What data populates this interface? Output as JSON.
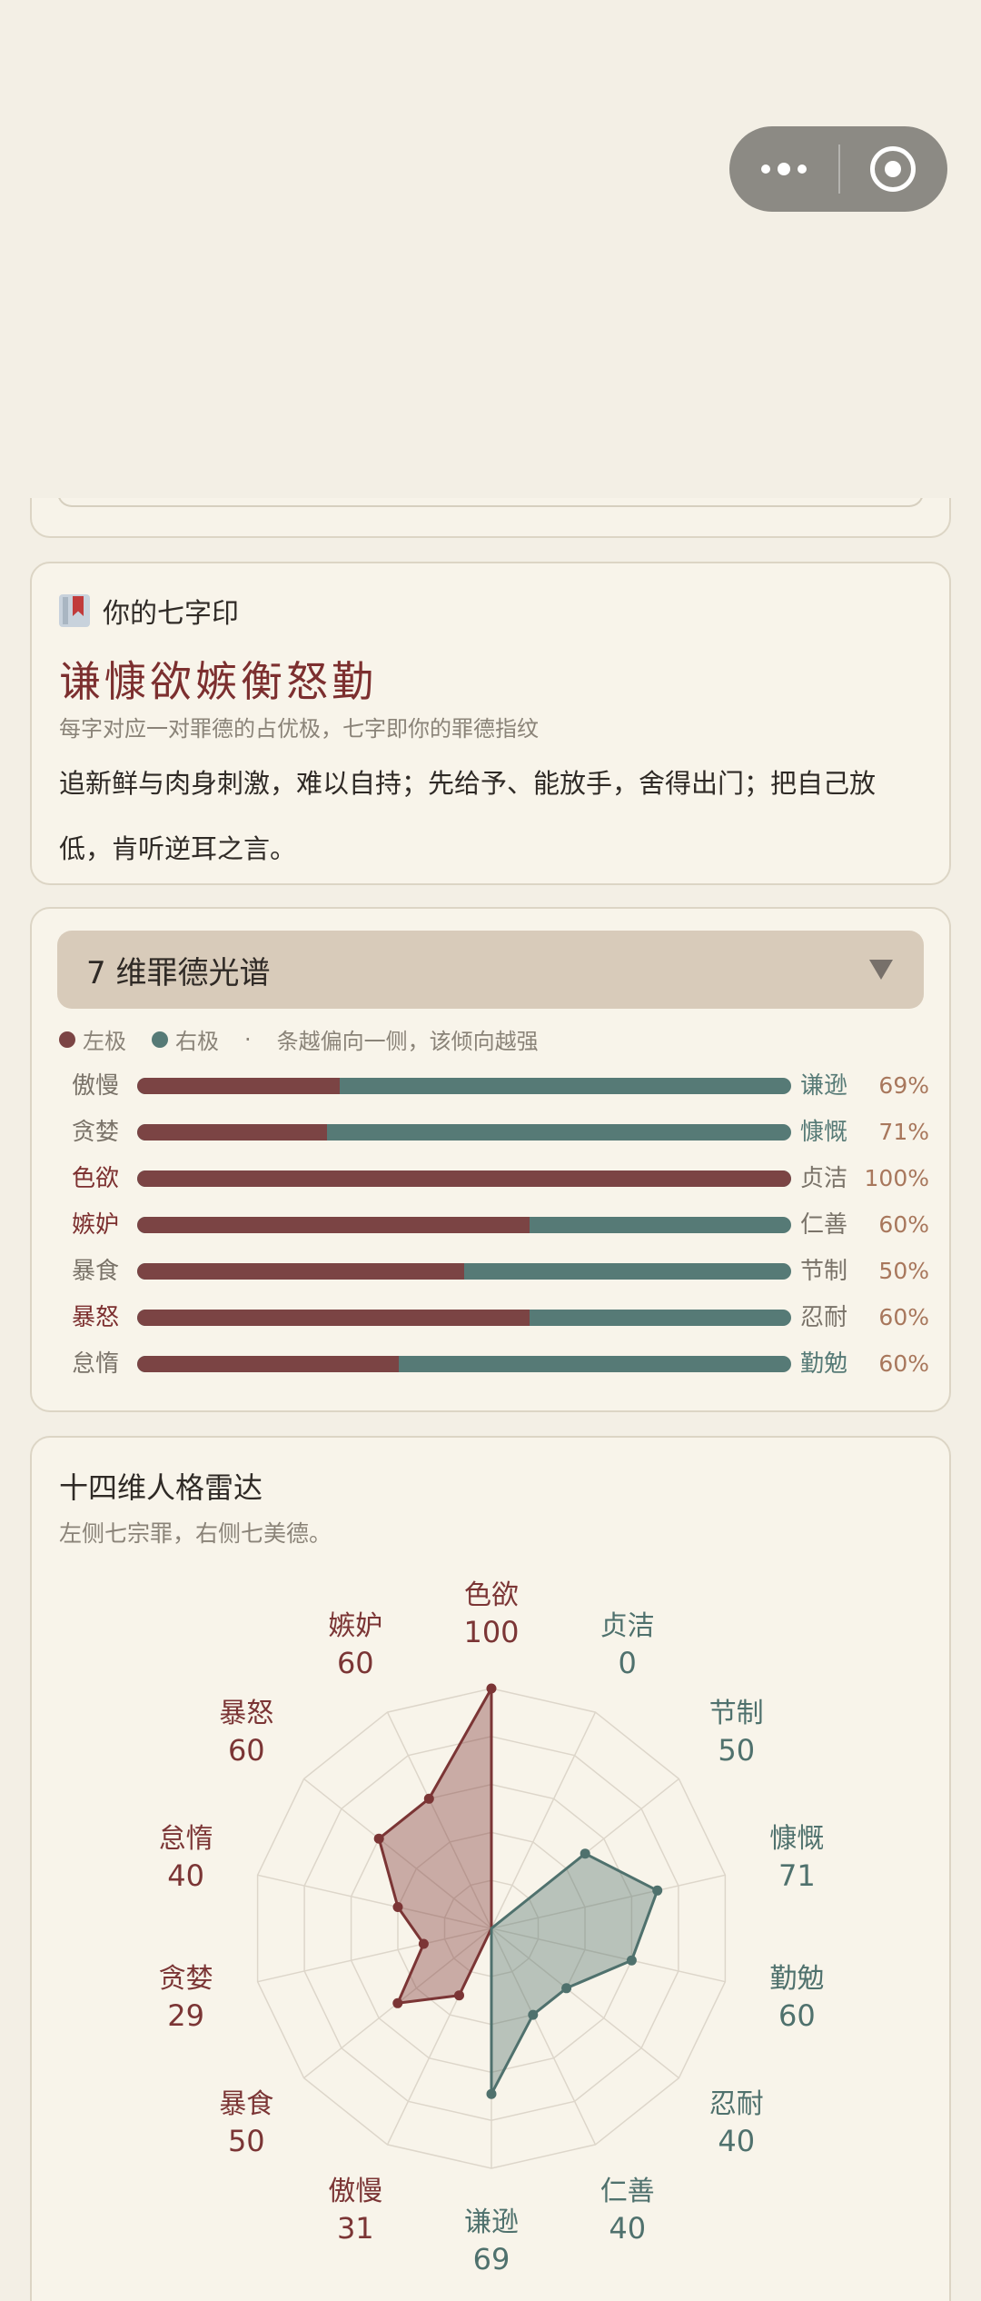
{
  "seal": {
    "title": "你的七字印",
    "chars": "谦慷欲嫉衡怒勤",
    "subtitle": "每字对应一对罪德的占优极，七字即你的罪德指纹",
    "description": "追新鲜与肉身刺激，难以自持；先给予、能放手，舍得出门；把自己放低，肯听逆耳之言。"
  },
  "spectrum": {
    "title": "7 维罪德光谱",
    "legend_left": "左极",
    "legend_right": "右极",
    "legend_dot": "·",
    "legend_note": "条越偏向一侧，该倾向越强",
    "colors": {
      "left": "#7b4444",
      "right": "#567a76"
    },
    "rows": [
      {
        "left": "傲慢",
        "right": "谦逊",
        "left_fraction": 0.31,
        "pct": "69%",
        "dominant": "right"
      },
      {
        "left": "贪婪",
        "right": "慷慨",
        "left_fraction": 0.29,
        "pct": "71%",
        "dominant": "right"
      },
      {
        "left": "色欲",
        "right": "贞洁",
        "left_fraction": 1.0,
        "pct": "100%",
        "dominant": "left"
      },
      {
        "left": "嫉妒",
        "right": "仁善",
        "left_fraction": 0.6,
        "pct": "60%",
        "dominant": "left"
      },
      {
        "left": "暴食",
        "right": "节制",
        "left_fraction": 0.5,
        "pct": "50%",
        "dominant": "none"
      },
      {
        "left": "暴怒",
        "right": "忍耐",
        "left_fraction": 0.6,
        "pct": "60%",
        "dominant": "left"
      },
      {
        "left": "怠惰",
        "right": "勤勉",
        "left_fraction": 0.4,
        "pct": "60%",
        "dominant": "right"
      }
    ]
  },
  "radar": {
    "title": "十四维人格雷达",
    "subtitle": "左侧七宗罪，右侧七美德。",
    "colors": {
      "sin": "#7b3535",
      "virtue": "#4f716d",
      "grid": "#ddd6ca"
    },
    "axes": [
      {
        "label": "色欲",
        "value": 100,
        "side": "sin"
      },
      {
        "label": "贞洁",
        "value": 0,
        "side": "virtue"
      },
      {
        "label": "节制",
        "value": 50,
        "side": "virtue"
      },
      {
        "label": "慷慨",
        "value": 71,
        "side": "virtue"
      },
      {
        "label": "勤勉",
        "value": 60,
        "side": "virtue"
      },
      {
        "label": "忍耐",
        "value": 40,
        "side": "virtue"
      },
      {
        "label": "仁善",
        "value": 40,
        "side": "virtue"
      },
      {
        "label": "谦逊",
        "value": 69,
        "side": "virtue"
      },
      {
        "label": "傲慢",
        "value": 31,
        "side": "sin"
      },
      {
        "label": "暴食",
        "value": 50,
        "side": "sin"
      },
      {
        "label": "贪婪",
        "value": 29,
        "side": "sin"
      },
      {
        "label": "怠惰",
        "value": 40,
        "side": "sin"
      },
      {
        "label": "暴怒",
        "value": 60,
        "side": "sin"
      },
      {
        "label": "嫉妒",
        "value": 60,
        "side": "sin"
      }
    ],
    "max": 100
  }
}
